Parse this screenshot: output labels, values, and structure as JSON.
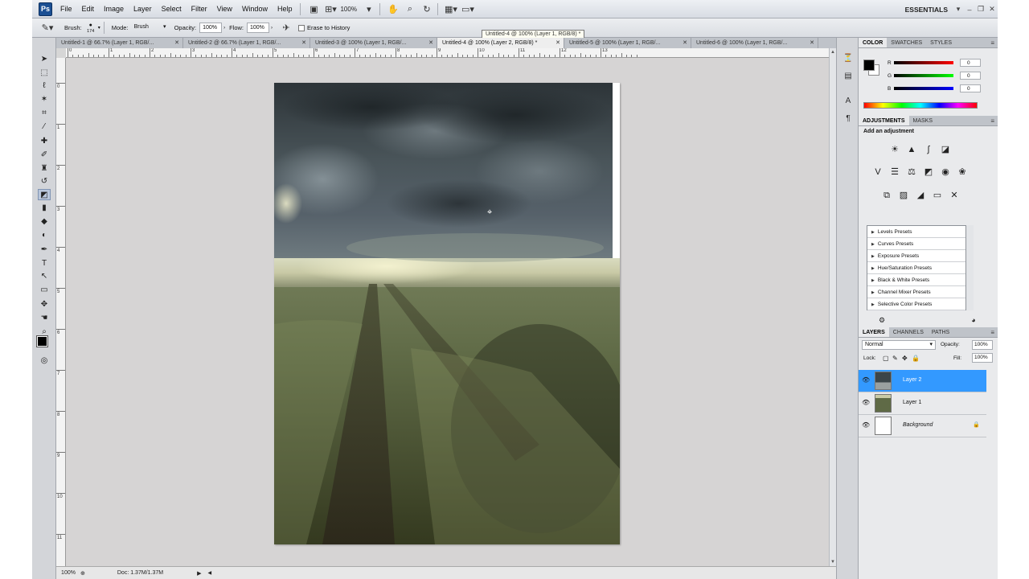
{
  "menubar": {
    "logo": "Ps",
    "items": [
      "File",
      "Edit",
      "Image",
      "Layer",
      "Select",
      "Filter",
      "View",
      "Window",
      "Help"
    ],
    "zoom": "100%",
    "workspace": "ESSENTIALS"
  },
  "options": {
    "brush_label": "Brush:",
    "brush_size": "174",
    "mode_label": "Mode:",
    "mode_value": "Brush",
    "opacity_label": "Opacity:",
    "opacity_value": "100%",
    "flow_label": "Flow:",
    "flow_value": "100%",
    "erase_history": "Erase to History"
  },
  "tabs": [
    {
      "label": "Untitled-1 @ 66.7% (Layer 1, RGB/..."
    },
    {
      "label": "Untitled-2 @ 66.7% (Layer 1, RGB/..."
    },
    {
      "label": "Untitled-3 @ 100% (Layer 1, RGB/..."
    },
    {
      "label": "Untitled-4 @ 100% (Layer 2, RGB/8) *"
    },
    {
      "label": "Untitled-5 @ 100% (Layer 1, RGB/..."
    },
    {
      "label": "Untitled-6 @ 100% (Layer 1, RGB/..."
    }
  ],
  "tooltip": "Untitled-4 @ 100% (Layer 1, RGB/8) *",
  "ruler_top": [
    "0",
    "1",
    "2",
    "3",
    "4",
    "5",
    "6",
    "7",
    "8",
    "9",
    "10",
    "11",
    "12",
    "13"
  ],
  "ruler_left": [
    "0",
    "1",
    "2",
    "3",
    "4",
    "5",
    "6",
    "7",
    "8",
    "9",
    "10",
    "11"
  ],
  "status": {
    "zoom": "100%",
    "doc": "Doc: 1.37M/1.37M"
  },
  "color_panel": {
    "tabs": [
      "COLOR",
      "SWATCHES",
      "STYLES"
    ],
    "channels": [
      {
        "name": "R",
        "value": "0"
      },
      {
        "name": "G",
        "value": "0"
      },
      {
        "name": "B",
        "value": "0"
      }
    ]
  },
  "adjustments_panel": {
    "tabs": [
      "ADJUSTMENTS",
      "MASKS"
    ],
    "title": "Add an adjustment",
    "presets": [
      "Levels Presets",
      "Curves Presets",
      "Exposure Presets",
      "Hue/Saturation Presets",
      "Black & White Presets",
      "Channel Mixer Presets",
      "Selective Color Presets"
    ]
  },
  "layers_panel": {
    "tabs": [
      "LAYERS",
      "CHANNELS",
      "PATHS"
    ],
    "blend_mode": "Normal",
    "opacity_label": "Opacity:",
    "opacity": "100%",
    "lock_label": "Lock:",
    "fill_label": "Fill:",
    "fill": "100%",
    "layers": [
      {
        "name": "Layer 2",
        "selected": true
      },
      {
        "name": "Layer 1",
        "selected": false
      },
      {
        "name": "Background",
        "selected": false
      }
    ]
  }
}
